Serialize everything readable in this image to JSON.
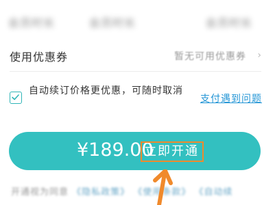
{
  "top_row": {
    "left": "会员时长",
    "middle": "会员时长",
    "right": "会员时长"
  },
  "coupon": {
    "label": "使用优惠券",
    "value": "暂无可用优惠券",
    "chevron": "›"
  },
  "auto_renew": {
    "text": "自动续订价格更优惠，可随时取消",
    "checked": true
  },
  "help_link": "支付遇到问题",
  "pay_button": {
    "price": "¥189.00",
    "action": "立即开通"
  },
  "terms": {
    "prefix": "开通视为同意",
    "privacy": "《隐私政策》",
    "usage": "《使用条款》",
    "auto": "《自动续"
  },
  "colors": {
    "accent": "#33c0c0",
    "link": "#2496d6",
    "highlight": "#f08a2c"
  },
  "icons": {
    "check": "check-icon",
    "arrow": "arrow-up-icon",
    "chevron": "chevron-right-icon"
  }
}
